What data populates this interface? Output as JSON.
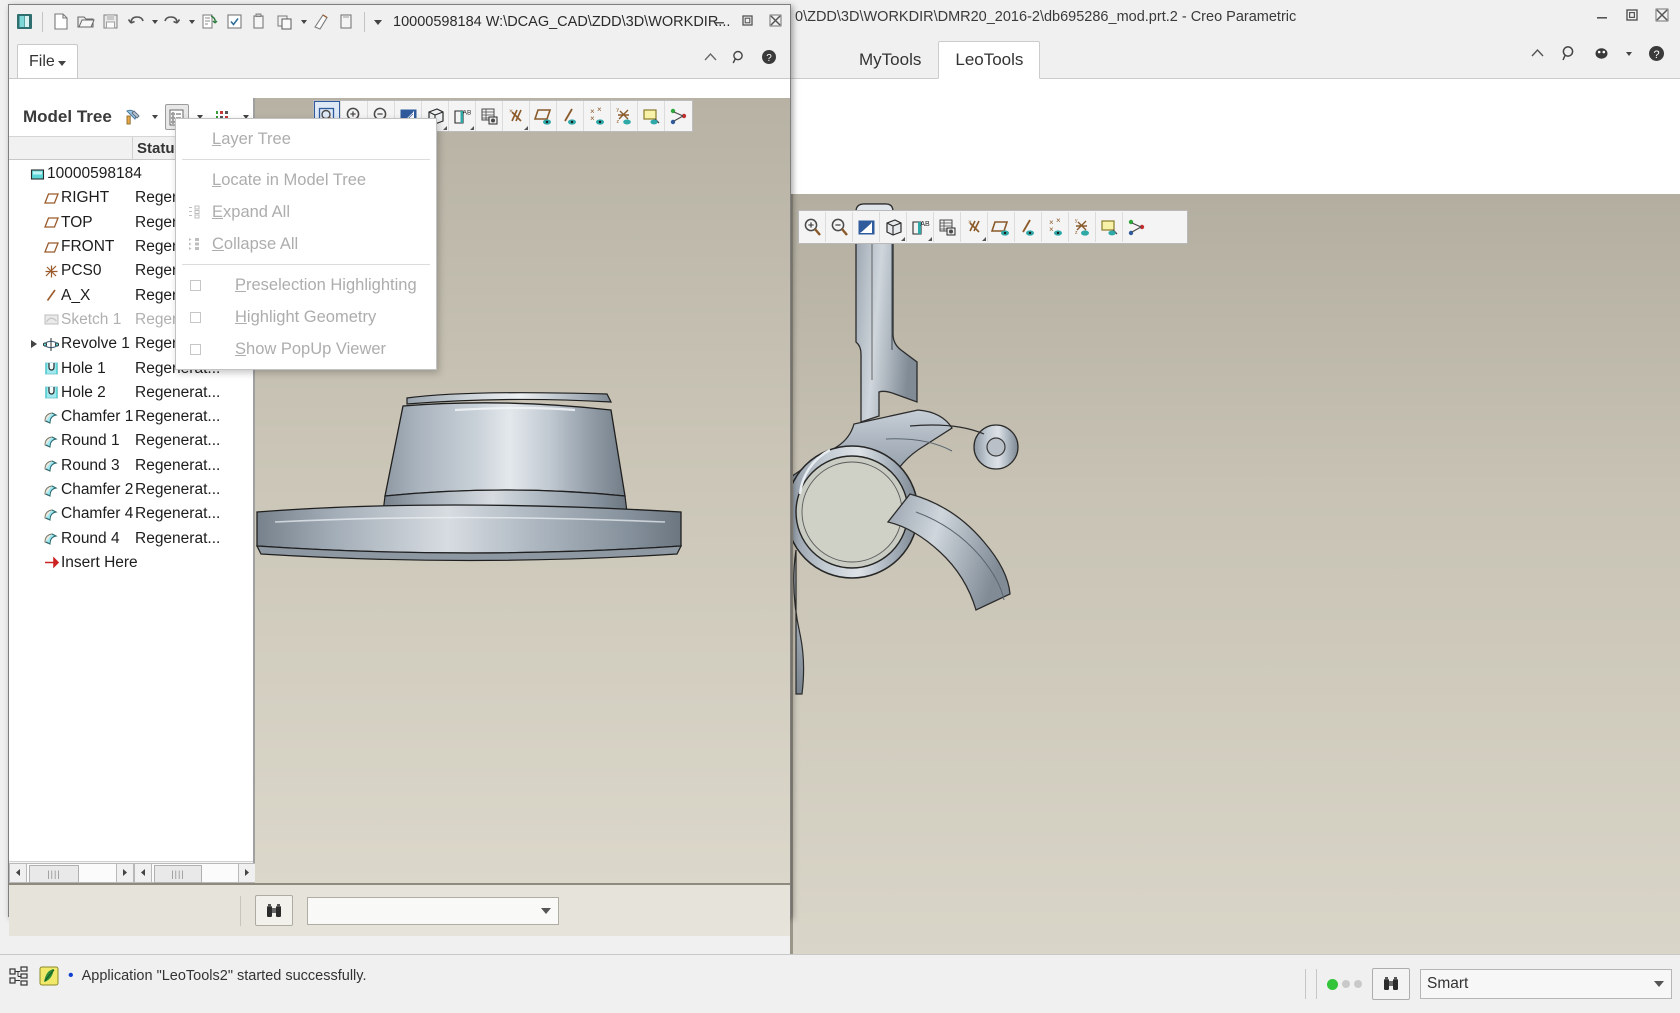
{
  "background_window": {
    "title": "0\\ZDD\\3D\\WORKDIR\\DMR20_2016-2\\db695286_mod.prt.2 - Creo Parametric",
    "tabs": [
      {
        "label": "MyTools",
        "active": false
      },
      {
        "label": "LeoTools",
        "active": true
      }
    ],
    "window_controls": [
      "minimize",
      "restore",
      "close"
    ],
    "right_icons": [
      "collapse-ribbon-icon",
      "search-icon",
      "account-icon",
      "help-icon"
    ]
  },
  "foreground_window": {
    "title": "10000598184 W:\\DCAG_CAD\\ZDD\\3D\\WORKDIR...",
    "quick_access": [
      "creo-logo-icon",
      "new-icon",
      "open-icon",
      "save-icon",
      "undo-icon",
      "redo-icon",
      "regenerate-icon",
      "checkbox-list-icon",
      "copy-icon",
      "paste-icon",
      "erase-icon",
      "close-window-icon"
    ],
    "file_tab": {
      "label": "File"
    },
    "right_icons": [
      "collapse-ribbon-icon",
      "search-icon",
      "help-icon"
    ],
    "window_controls": [
      "minimize",
      "restore",
      "close"
    ]
  },
  "model_tree": {
    "title": "Model Tree",
    "toolbar_icons": [
      "filter-settings-icon",
      "tree-columns-icon",
      "tree-display-icon"
    ],
    "columns": [
      "",
      "Status"
    ],
    "items": [
      {
        "label": "10000598184",
        "status": "",
        "icon": "part-icon",
        "indent": 0,
        "expander": false,
        "dim": false
      },
      {
        "label": "RIGHT",
        "status": "Regenerat...",
        "icon": "datum-plane-icon",
        "indent": 1,
        "expander": false,
        "dim": false
      },
      {
        "label": "TOP",
        "status": "Regenerat...",
        "icon": "datum-plane-icon",
        "indent": 1,
        "expander": false,
        "dim": false
      },
      {
        "label": "FRONT",
        "status": "Regenerat...",
        "icon": "datum-plane-icon",
        "indent": 1,
        "expander": false,
        "dim": false
      },
      {
        "label": "PCS0",
        "status": "Regenerat...",
        "icon": "coordinate-system-icon",
        "indent": 1,
        "expander": false,
        "dim": false
      },
      {
        "label": "A_X",
        "status": "Regenerat...",
        "icon": "datum-axis-icon",
        "indent": 1,
        "expander": false,
        "dim": false
      },
      {
        "label": "Sketch 1",
        "status": "Regenerat...",
        "icon": "sketch-icon",
        "indent": 1,
        "expander": false,
        "dim": true
      },
      {
        "label": "Revolve 1",
        "status": "Regenerat...",
        "icon": "revolve-icon",
        "indent": 1,
        "expander": true,
        "dim": false
      },
      {
        "label": "Hole 1",
        "status": "Regenerat...",
        "icon": "hole-icon",
        "indent": 1,
        "expander": false,
        "dim": false
      },
      {
        "label": "Hole 2",
        "status": "Regenerat...",
        "icon": "hole-icon",
        "indent": 1,
        "expander": false,
        "dim": false
      },
      {
        "label": "Chamfer 1",
        "status": "Regenerat...",
        "icon": "chamfer-icon",
        "indent": 1,
        "expander": false,
        "dim": false
      },
      {
        "label": "Round 1",
        "status": "Regenerat...",
        "icon": "round-icon",
        "indent": 1,
        "expander": false,
        "dim": false
      },
      {
        "label": "Round 3",
        "status": "Regenerat...",
        "icon": "round-icon",
        "indent": 1,
        "expander": false,
        "dim": false
      },
      {
        "label": "Chamfer 2",
        "status": "Regenerat...",
        "icon": "chamfer-icon",
        "indent": 1,
        "expander": false,
        "dim": false
      },
      {
        "label": "Chamfer 4",
        "status": "Regenerat...",
        "icon": "chamfer-icon",
        "indent": 1,
        "expander": false,
        "dim": false
      },
      {
        "label": "Round 4",
        "status": "Regenerat...",
        "icon": "round-icon",
        "indent": 1,
        "expander": false,
        "dim": false
      },
      {
        "label": "Insert Here",
        "status": "",
        "icon": "insert-here-icon",
        "indent": 1,
        "expander": false,
        "dim": false
      }
    ]
  },
  "context_menu": {
    "items": [
      {
        "label": "Layer Tree",
        "accel": "L",
        "icon": "",
        "checkbox": false,
        "disabled": true
      },
      {
        "separator": true
      },
      {
        "label": "Locate in Model Tree",
        "accel": "L",
        "icon": "",
        "checkbox": false,
        "disabled": true
      },
      {
        "label": "Expand  All",
        "accel": "E",
        "icon": "expand-all-icon",
        "checkbox": false,
        "disabled": true
      },
      {
        "label": "Collapse All",
        "accel": "C",
        "icon": "collapse-all-icon",
        "checkbox": false,
        "disabled": true
      },
      {
        "separator": true
      },
      {
        "label": "Preselection Highlighting",
        "accel": "P",
        "icon": "",
        "checkbox": true,
        "disabled": true
      },
      {
        "label": "Highlight Geometry",
        "accel": "H",
        "icon": "",
        "checkbox": true,
        "disabled": true
      },
      {
        "label": "Show PopUp Viewer",
        "accel": "S",
        "icon": "",
        "checkbox": true,
        "disabled": true
      }
    ]
  },
  "graphics_toolbar": {
    "items": [
      {
        "name": "zoom-to-fit-icon",
        "selected": true
      },
      {
        "name": "zoom-in-icon",
        "selected": false
      },
      {
        "name": "zoom-out-icon",
        "selected": false
      },
      {
        "name": "repaint-icon",
        "selected": false
      },
      {
        "name": "display-style-icon",
        "selected": false
      },
      {
        "name": "annotation-display-icon",
        "selected": false
      },
      {
        "name": "layers-icon",
        "selected": false
      },
      {
        "name": "datum-display-filters-icon",
        "selected": false
      },
      {
        "name": "plane-display-icon",
        "selected": false
      },
      {
        "name": "axis-display-icon",
        "selected": false
      },
      {
        "name": "point-display-icon",
        "selected": false
      },
      {
        "name": "csys-display-icon",
        "selected": false
      },
      {
        "name": "annotation-plane-icon",
        "selected": false
      },
      {
        "name": "spin-center-icon",
        "selected": false
      }
    ]
  },
  "graphics_toolbar_bg": {
    "items": [
      {
        "name": "zoom-in-icon"
      },
      {
        "name": "zoom-out-icon"
      },
      {
        "name": "repaint-icon"
      },
      {
        "name": "display-style-icon"
      },
      {
        "name": "annotation-display-icon"
      },
      {
        "name": "layers-icon"
      },
      {
        "name": "datum-display-filters-icon"
      },
      {
        "name": "plane-display-icon"
      },
      {
        "name": "axis-display-icon"
      },
      {
        "name": "point-display-icon"
      },
      {
        "name": "csys-display-icon"
      },
      {
        "name": "annotation-plane-icon"
      },
      {
        "name": "spin-center-icon"
      }
    ]
  },
  "child_bottom_bar": {
    "search_button": "binoculars-icon",
    "combo_value": ""
  },
  "status_bar": {
    "left_icons": [
      "model-tree-toggle-icon",
      "leotools-icon"
    ],
    "message": "Application \"LeoTools2\" started successfully.",
    "leds": [
      "#34c43a",
      "#c9c9c9",
      "#c9c9c9"
    ],
    "search_button": "binoculars-icon",
    "selection_filter": "Smart"
  },
  "colors": {
    "graphics_bg_top": "#b7b2a4",
    "graphics_bg_bottom": "#dbd7ca",
    "part_metal_light": "#d7dde3",
    "part_metal_mid": "#9fa9b4",
    "part_metal_dark": "#6f7a86",
    "accent_blue": "#2f5b9c",
    "led_green": "#34c43a",
    "insert_red": "#cc2222"
  }
}
